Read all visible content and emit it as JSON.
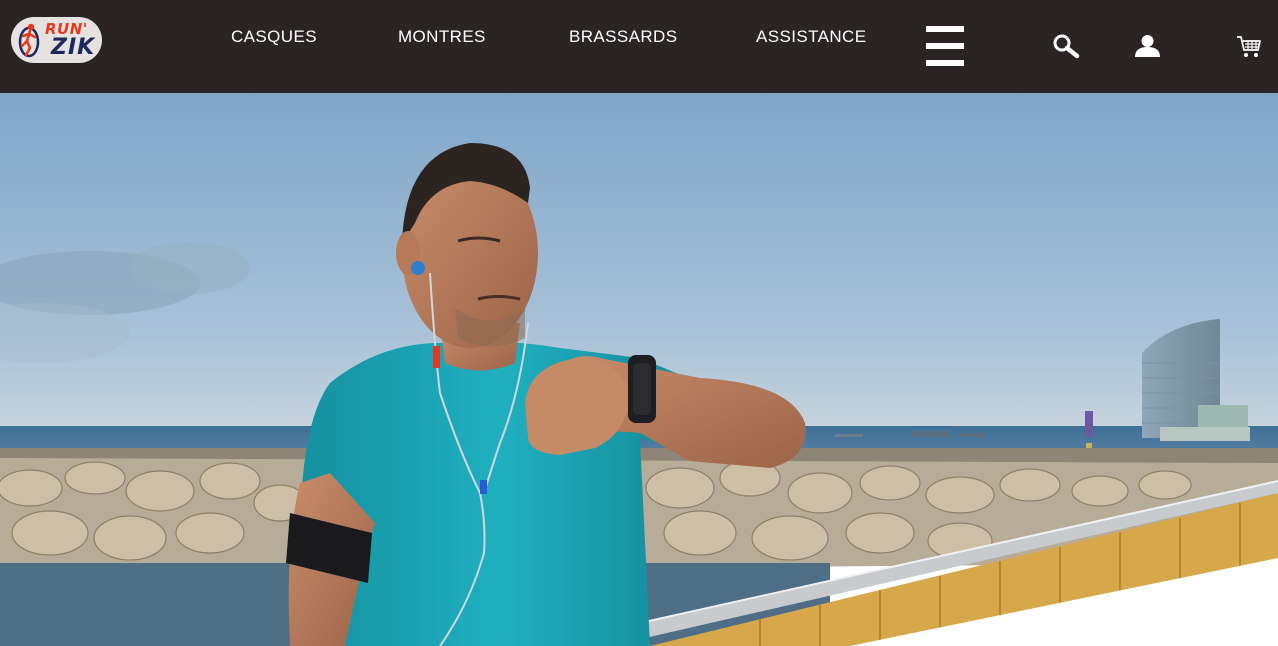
{
  "brand": {
    "logo_line1": "RUN'",
    "logo_line2": "ZIK",
    "colors": {
      "header_bg": "#2b2424",
      "logo_red": "#e8381b",
      "logo_navy": "#1b2a5e",
      "shirt_teal": "#1aa8b8"
    }
  },
  "nav": {
    "items": [
      {
        "label": "CASQUES"
      },
      {
        "label": "MONTRES"
      },
      {
        "label": "BRASSARDS"
      },
      {
        "label": "ASSISTANCE"
      }
    ]
  },
  "icons": {
    "menu": "hamburger-menu-icon",
    "search": "search-icon",
    "account": "user-account-icon",
    "cart": "shopping-cart-icon"
  },
  "hero": {
    "image": "runner-checking-smartwatch-by-seaside"
  }
}
